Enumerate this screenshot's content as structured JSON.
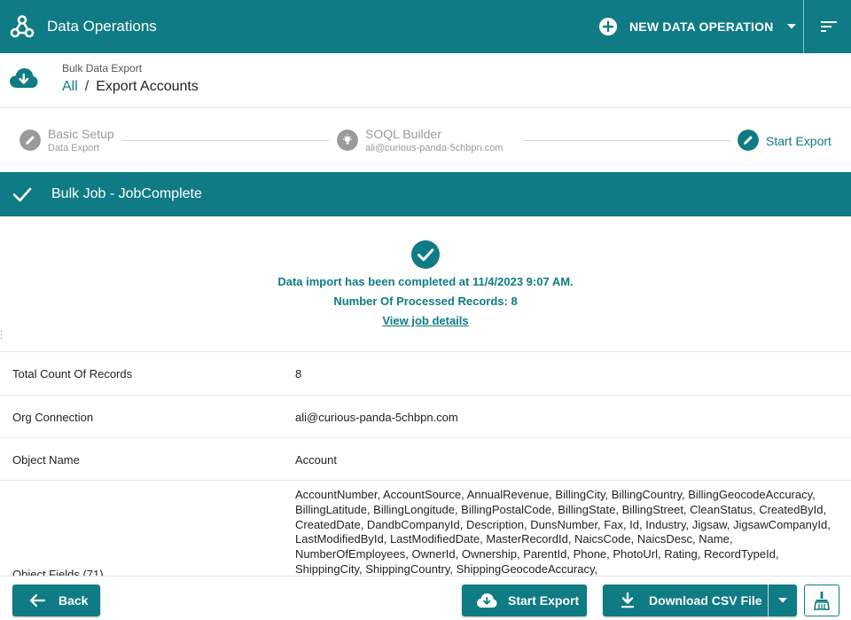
{
  "topbar": {
    "app_title": "Data Operations",
    "new_operation_label": "NEW DATA OPERATION",
    "icons": [
      "webhook-logo-icon",
      "plus-circle-icon",
      "caret-down-icon",
      "filter-list-icon"
    ]
  },
  "header": {
    "eyebrow": "Bulk Data Export",
    "breadcrumb": {
      "root": "All",
      "separator": "/",
      "current": "Export Accounts"
    }
  },
  "stepper": {
    "steps": [
      {
        "title": "Basic Setup",
        "subtitle": "Data Export",
        "state": "done",
        "icon": "pencil-icon"
      },
      {
        "title": "SOQL Builder",
        "subtitle": "ali@curious-panda-5chbpn.com",
        "state": "done",
        "icon": "bulb-icon"
      },
      {
        "title": "Start Export",
        "subtitle": "",
        "state": "active",
        "icon": "pencil-icon"
      }
    ]
  },
  "banner": {
    "title": "Bulk Job - JobComplete"
  },
  "status": {
    "completed_message": "Data import has been completed at 11/4/2023 9:07 AM.",
    "processed_label": "Number Of Processed Records: ",
    "processed_count": "8",
    "view_details_link": "View job details"
  },
  "details": [
    {
      "label": "Total Count Of Records",
      "value": "8"
    },
    {
      "label": "Org Connection",
      "value": "ali@curious-panda-5chbpn.com"
    },
    {
      "label": "Object Name",
      "value": "Account"
    },
    {
      "label": "Object Fields (71)",
      "value": "AccountNumber, AccountSource, AnnualRevenue, BillingCity, BillingCountry, BillingGeocodeAccuracy, BillingLatitude, BillingLongitude, BillingPostalCode, BillingState, BillingStreet, CleanStatus, CreatedById, CreatedDate, DandbCompanyId, Description, DunsNumber, Fax, Id, Industry, Jigsaw, JigsawCompanyId, LastModifiedById, LastModifiedDate, MasterRecordId, NaicsCode, NaicsDesc, Name, NumberOfEmployees, OwnerId, Ownership, ParentId, Phone, PhotoUrl, Rating, RecordTypeId, ShippingCity, ShippingCountry, ShippingGeocodeAccuracy,"
    }
  ],
  "footer": {
    "back_label": "Back",
    "start_export_label": "Start Export",
    "download_label": "Download CSV File"
  },
  "colors": {
    "brand": "#0f7b84",
    "disabled": "#9a9a9a",
    "divider": "#e6e6e6"
  }
}
